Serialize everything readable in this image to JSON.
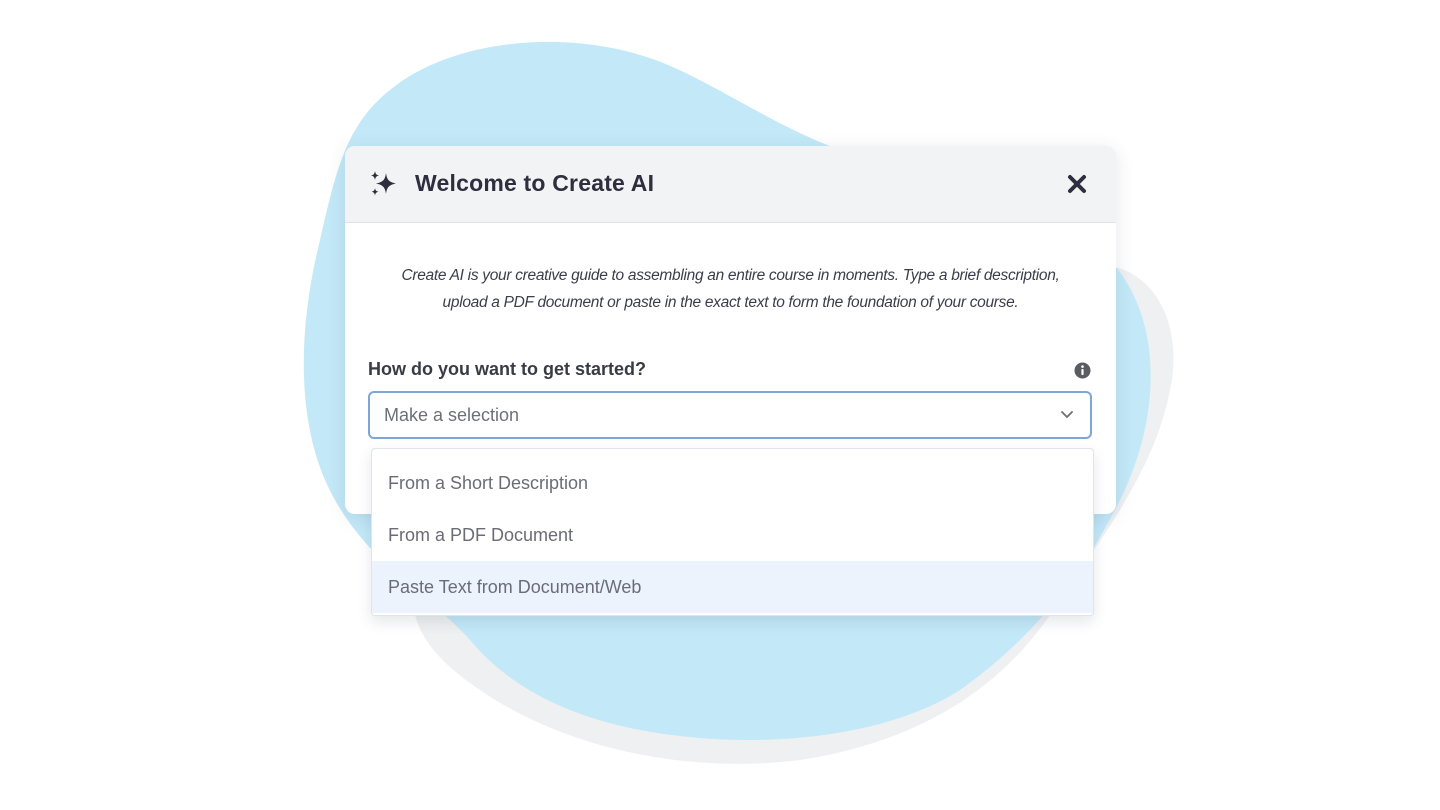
{
  "modal": {
    "title": "Welcome to Create AI",
    "description_line1": "Create AI is your creative guide to assembling an entire course in moments. Type a brief description,",
    "description_line2": "upload a PDF document or paste in the exact text to form the foundation of your course.",
    "question_label": "How do you want to get started?",
    "select": {
      "placeholder": "Make a selection",
      "options": [
        {
          "label": "From a Short Description",
          "highlighted": false
        },
        {
          "label": "From a PDF Document",
          "highlighted": false
        },
        {
          "label": "Paste Text from Document/Web",
          "highlighted": true
        }
      ]
    }
  },
  "icons": {
    "header": "sparkles-icon",
    "close": "close-icon",
    "info": "info-icon",
    "chevron": "chevron-down-icon"
  },
  "colors": {
    "blob": "#c3e9f8",
    "blob_shadow": "#eceef1",
    "header_bg": "#f2f3f5",
    "title": "#2e2f3e",
    "select_border": "#7ea6d8",
    "option_highlight": "#ecf3fc"
  }
}
